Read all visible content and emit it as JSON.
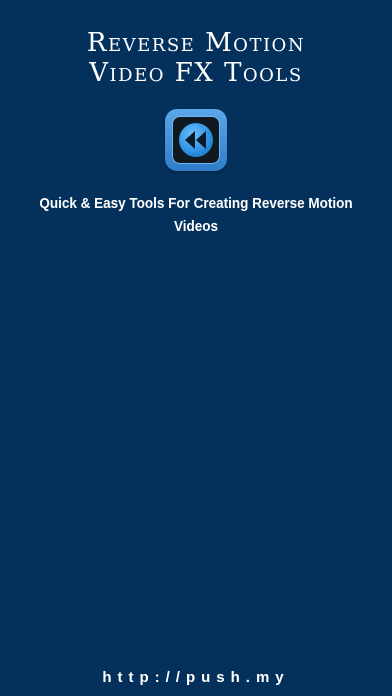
{
  "header": {
    "title_line1": "Reverse Motion",
    "title_line2": "Video FX Tools"
  },
  "app_icon": {
    "icon_name": "rewind-icon",
    "accent_color": "#2f7cc9"
  },
  "tagline": "Quick & Easy Tools For Creating Reverse Motion Videos",
  "footer": {
    "url": "http://push.my"
  },
  "colors": {
    "background": "#04305c",
    "text": "#ffffff"
  }
}
